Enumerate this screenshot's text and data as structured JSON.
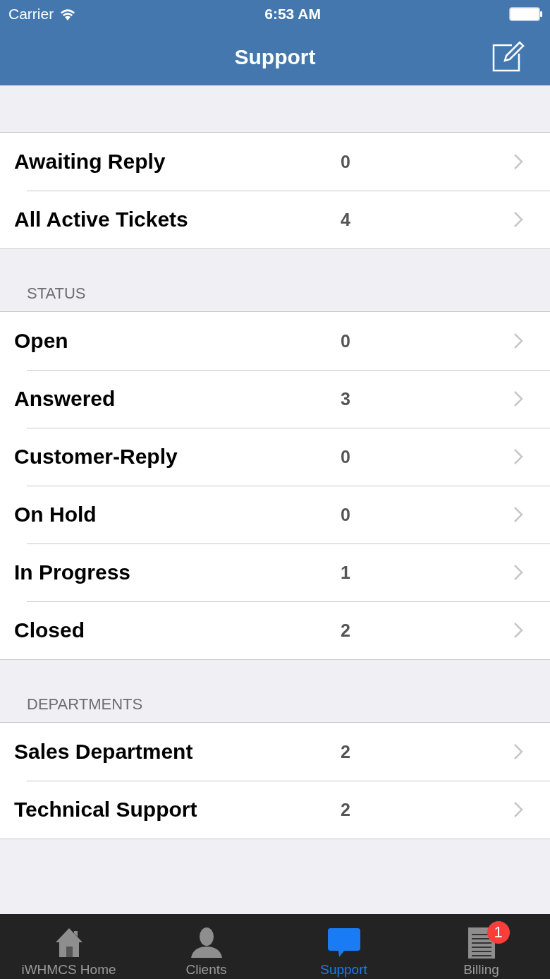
{
  "status_bar": {
    "carrier": "Carrier",
    "time": "6:53 AM"
  },
  "nav": {
    "title": "Support"
  },
  "sections": [
    {
      "items": [
        {
          "label": "Awaiting Reply",
          "count": "0"
        },
        {
          "label": "All Active Tickets",
          "count": "4"
        }
      ]
    },
    {
      "header": "STATUS",
      "items": [
        {
          "label": "Open",
          "count": "0"
        },
        {
          "label": "Answered",
          "count": "3"
        },
        {
          "label": "Customer-Reply",
          "count": "0"
        },
        {
          "label": "On Hold",
          "count": "0"
        },
        {
          "label": "In Progress",
          "count": "1"
        },
        {
          "label": "Closed",
          "count": "2"
        }
      ]
    },
    {
      "header": "DEPARTMENTS",
      "items": [
        {
          "label": "Sales Department",
          "count": "2"
        },
        {
          "label": "Technical Support",
          "count": "2"
        }
      ]
    }
  ],
  "tab_bar": [
    {
      "kind": "home",
      "label": "iWHMCS Home",
      "selected": false
    },
    {
      "kind": "person",
      "label": "Clients",
      "selected": false
    },
    {
      "kind": "chat",
      "label": "Support",
      "selected": true
    },
    {
      "kind": "document",
      "label": "Billing",
      "selected": false,
      "badge": "1"
    }
  ]
}
